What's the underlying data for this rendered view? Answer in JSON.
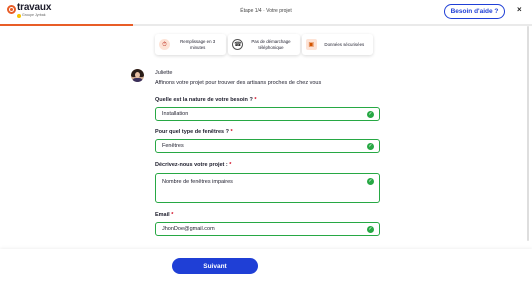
{
  "header": {
    "logo_word": "travaux",
    "logo_tagline": "Groupe Jyrbak",
    "step_label": "Étape 1/4 · Votre projet",
    "help_button": "Besoin d'aide ?",
    "close_symbol": "×",
    "progress": 0.25,
    "accent_color": "#e85d27",
    "brand_blue": "#1f3fd6"
  },
  "features": [
    {
      "icon": "timer-icon",
      "label": "Remplissage en 3 minutes"
    },
    {
      "icon": "phone-icon",
      "label": "Pas de démarchage téléphonique"
    },
    {
      "icon": "lock-icon",
      "label": "Données sécurisées"
    }
  ],
  "agent": {
    "name": "Juliette",
    "message": "Affinons votre projet pour trouver des artisans proches de chez vous"
  },
  "form": {
    "nature": {
      "label": "Quelle est la nature de votre besoin ?",
      "required": "*",
      "value": "Installation"
    },
    "type": {
      "label": "Pour quel type de fenêtres ?",
      "required": "*",
      "value": "Fenêtres"
    },
    "description": {
      "label": "Décrivez-nous votre projet :",
      "required": "*",
      "value": "Nombre de fenêtres impaires"
    },
    "email": {
      "label": "Email",
      "required": "*",
      "value": "JhonDoe@gmail.com"
    },
    "valid_color": "#27a844"
  },
  "footer": {
    "next_button": "Suivant"
  }
}
